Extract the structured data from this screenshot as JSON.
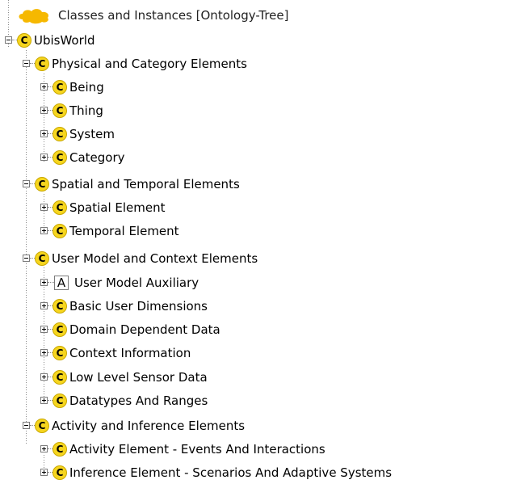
{
  "root": {
    "label": "Classes and Instances [Ontology-Tree]",
    "icon": "cloud-icon",
    "icon_color": "#f6b800"
  },
  "colors": {
    "class_badge": "#f6d51e",
    "class_badge_border": "#c9a800",
    "connector": "#8a8a8a"
  },
  "tree": {
    "top": {
      "label": "UbisWorld",
      "badge": "C",
      "expanded": true
    },
    "groups": [
      {
        "label": "Physical and Category Elements",
        "badge": "C",
        "expanded": true,
        "children": [
          {
            "label": "Being",
            "badge": "C",
            "expanded": false
          },
          {
            "label": "Thing",
            "badge": "C",
            "expanded": false
          },
          {
            "label": "System",
            "badge": "C",
            "expanded": false
          },
          {
            "label": "Category",
            "badge": "C",
            "expanded": false
          }
        ]
      },
      {
        "label": "Spatial and Temporal Elements",
        "badge": "C",
        "expanded": true,
        "children": [
          {
            "label": "Spatial Element",
            "badge": "C",
            "expanded": false
          },
          {
            "label": "Temporal Element",
            "badge": "C",
            "expanded": false
          }
        ]
      },
      {
        "label": "User Model and Context Elements",
        "badge": "C",
        "expanded": true,
        "children": [
          {
            "label": "User Model Auxiliary",
            "badge": "A",
            "expanded": false
          },
          {
            "label": "Basic User Dimensions",
            "badge": "C",
            "expanded": false
          },
          {
            "label": "Domain Dependent Data",
            "badge": "C",
            "expanded": false
          },
          {
            "label": "Context Information",
            "badge": "C",
            "expanded": false
          },
          {
            "label": "Low Level Sensor Data",
            "badge": "C",
            "expanded": false
          },
          {
            "label": "Datatypes And Ranges",
            "badge": "C",
            "expanded": false
          }
        ]
      },
      {
        "label": "Activity and Inference Elements",
        "badge": "C",
        "expanded": true,
        "children": [
          {
            "label": "Activity Element - Events And Interactions",
            "badge": "C",
            "expanded": false
          },
          {
            "label": "Inference Element - Scenarios And Adaptive Systems",
            "badge": "C",
            "expanded": false
          }
        ]
      }
    ]
  }
}
